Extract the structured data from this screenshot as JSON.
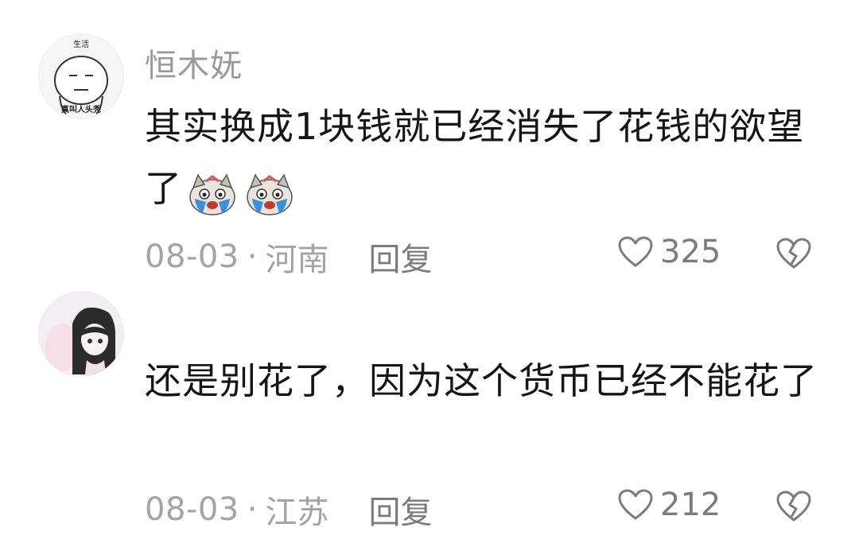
{
  "comments": [
    {
      "username": "恒木妩",
      "avatar_text_top": "生活",
      "avatar_text_bottom": "真叫人头秃",
      "text": "其实换成1块钱就已经消失了花钱的欲望了",
      "emojis": [
        "crying-cat-emoji",
        "crying-cat-emoji"
      ],
      "date": "08-03",
      "separator": "·",
      "location": "河南",
      "reply_label": "回复",
      "likes": "325"
    },
    {
      "username": "",
      "text": "还是别花了，因为这个货币已经不能花了",
      "date": "08-03",
      "separator": "·",
      "location": "江苏",
      "reply_label": "回复",
      "likes": "212"
    }
  ],
  "colors": {
    "meta": "#a4a4a4",
    "username": "#9a9a9a",
    "text": "#161616",
    "action": "#7c7c7c"
  }
}
